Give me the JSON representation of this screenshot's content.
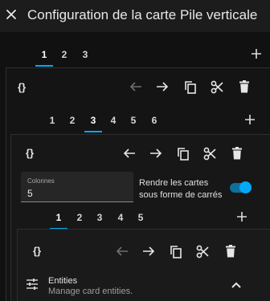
{
  "dialog": {
    "title": "Configuration de la carte Pile verticale"
  },
  "level1": {
    "tabs": [
      "1",
      "2",
      "3"
    ],
    "active_tab": "1"
  },
  "level2": {
    "tabs": [
      "1",
      "2",
      "3",
      "4",
      "5",
      "6"
    ],
    "active_tab": "3"
  },
  "level3": {
    "tabs": [
      "1",
      "2",
      "3",
      "4",
      "5"
    ],
    "active_tab": "1"
  },
  "columns_field": {
    "label": "Colonnes",
    "value": "5"
  },
  "square_toggle": {
    "label": "Rendre les cartes sous forme de carrés",
    "checked": true
  },
  "entities_section": {
    "title": "Entities",
    "subtitle": "Manage card entities."
  },
  "toolbar": {
    "code_glyph": "{}"
  },
  "colors": {
    "accent": "#03a9f4",
    "background": "#111111"
  }
}
